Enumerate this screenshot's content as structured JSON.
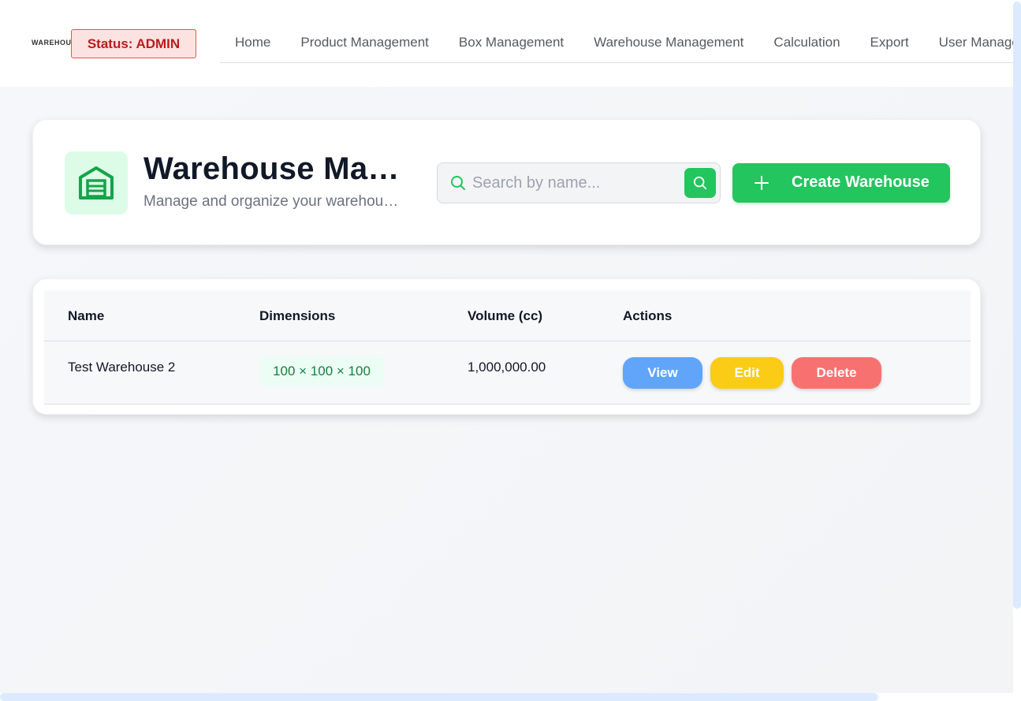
{
  "topbar": {
    "logo_text": "WAREHOUSE",
    "status_label": "Status:",
    "status_value": "ADMIN",
    "nav": [
      "Home",
      "Product Management",
      "Box Management",
      "Warehouse Management",
      "Calculation",
      "Export",
      "User Management"
    ]
  },
  "header": {
    "title": "Warehouse Ma…",
    "subtitle": "Manage and organize your warehou…",
    "search_placeholder": "Search by name...",
    "create_label": "Create Warehouse",
    "icon": "warehouse-icon"
  },
  "table": {
    "columns": [
      "Name",
      "Dimensions",
      "Volume (cc)",
      "Actions"
    ],
    "rows": [
      {
        "name": "Test Warehouse 2",
        "dimensions": "100 × 100 × 100",
        "volume": "1,000,000.00"
      }
    ],
    "actions": {
      "view": "View",
      "edit": "Edit",
      "delete": "Delete"
    }
  },
  "colors": {
    "primary": "#22c55e",
    "view": "#60a5fa",
    "edit": "#facc15",
    "delete": "#f87171",
    "status_bg": "#fde2e2",
    "status_text": "#b91c1c"
  }
}
